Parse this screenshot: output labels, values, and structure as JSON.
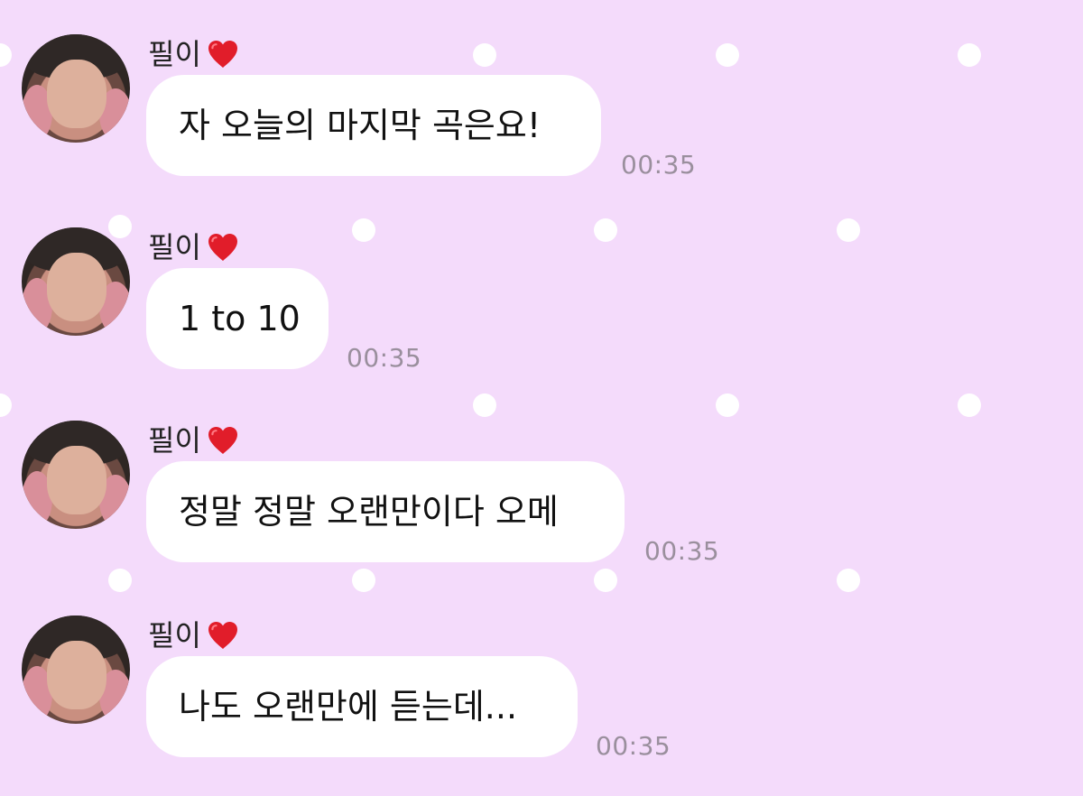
{
  "chat": {
    "background_color": "#f4dbfb",
    "dot_color": "#ffffff",
    "messages": [
      {
        "sender": "필이",
        "sender_icon": "red-heart-icon",
        "text": "자 오늘의 마지막 곡은요!",
        "time": "00:35"
      },
      {
        "sender": "필이",
        "sender_icon": "red-heart-icon",
        "text": "1 to 10",
        "time": "00:35"
      },
      {
        "sender": "필이",
        "sender_icon": "red-heart-icon",
        "text": "정말 정말 오랜만이다 오메",
        "time": "00:35"
      },
      {
        "sender": "필이",
        "sender_icon": "red-heart-icon",
        "text": "나도 오랜만에 듣는데...",
        "time": "00:35"
      }
    ]
  }
}
